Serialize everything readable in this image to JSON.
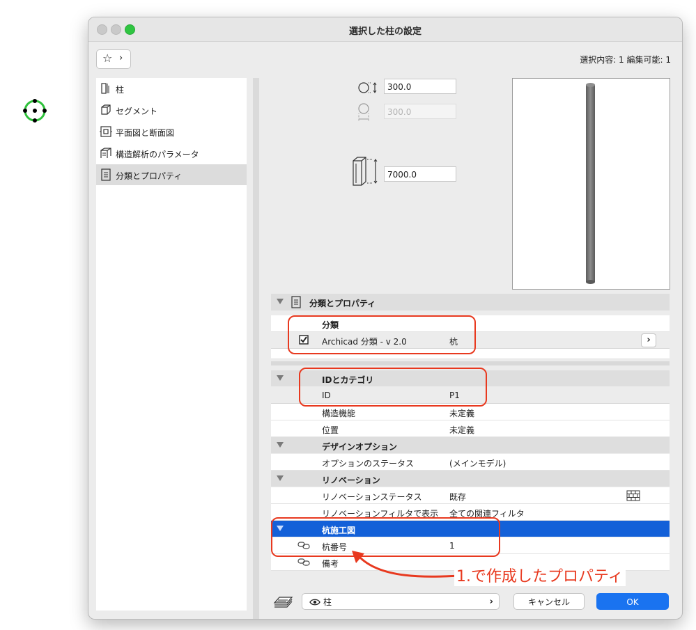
{
  "window": {
    "title": "選択した柱の設定",
    "selection_info": "選択内容: 1 編集可能: 1"
  },
  "sidebar": {
    "items": [
      {
        "label": "柱",
        "icon": "column-icon"
      },
      {
        "label": "セグメント",
        "icon": "segment-icon"
      },
      {
        "label": "平面図と断面図",
        "icon": "floor-plan-section-icon"
      },
      {
        "label": "構造解析のパラメータ",
        "icon": "structural-analysis-icon"
      },
      {
        "label": "分類とプロパティ",
        "icon": "classification-icon",
        "selected": true
      }
    ]
  },
  "dimensions": {
    "width": "300.0",
    "depth": "300.0",
    "height": "7000.0"
  },
  "section": {
    "title": "分類とプロパティ"
  },
  "classification": {
    "header": "分類",
    "row": {
      "name": "Archicad 分類 - v 2.0",
      "value": "杭",
      "checked": true
    }
  },
  "groups": {
    "id_category": {
      "header": "IDとカテゴリ",
      "rows": [
        {
          "name": "ID",
          "value": "P1"
        },
        {
          "name": "構造機能",
          "value": "未定義"
        },
        {
          "name": "位置",
          "value": "未定義"
        }
      ]
    },
    "design_option": {
      "header": "デザインオプション",
      "rows": [
        {
          "name": "オプションのステータス",
          "value": "(メインモデル)"
        }
      ]
    },
    "renovation": {
      "header": "リノベーション",
      "rows": [
        {
          "name": "リノベーションステータス",
          "value": "既存"
        },
        {
          "name": "リノベーションフィルタで表示",
          "value": "全ての関連フィルタ"
        }
      ]
    },
    "pile": {
      "header": "杭施工図",
      "rows": [
        {
          "name": "杭番号",
          "value": "1"
        },
        {
          "name": "備考",
          "value": ""
        }
      ]
    }
  },
  "annotation": {
    "text": "1.で作成したプロパティ",
    "color": "#e8391f"
  },
  "footer": {
    "layer": "柱",
    "cancel": "キャンセル",
    "ok": "OK"
  },
  "colors": {
    "accent": "#1a73f0",
    "selected_group": "#1360d8",
    "highlight": "#e8391f",
    "marker": "#2ec13a"
  }
}
